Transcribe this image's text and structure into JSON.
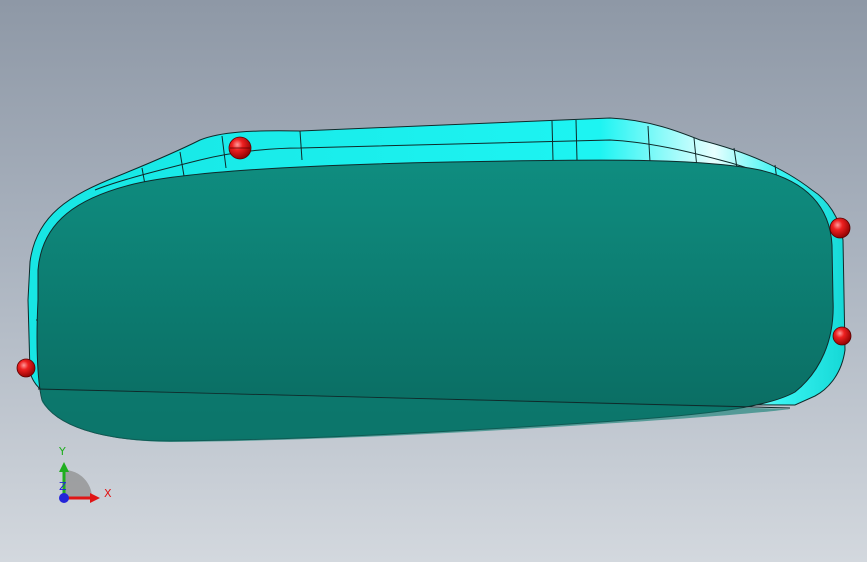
{
  "viewport": {
    "name": "3d-model-viewport"
  },
  "model": {
    "colors": {
      "rim": "#19f0ee",
      "rim_highlight": "#e8ffff",
      "face_top": "#0f8b7f",
      "face_bottom": "#0b6f64",
      "edge": "#0f2a2a",
      "handle": "#e01010",
      "handle_highlight": "#ff8080"
    },
    "handle_count": 4
  },
  "triad": {
    "x_label": "X",
    "y_label": "Y",
    "z_label": "Z",
    "colors": {
      "x": "#e01515",
      "y": "#1fae1f",
      "z": "#2424d8"
    }
  }
}
